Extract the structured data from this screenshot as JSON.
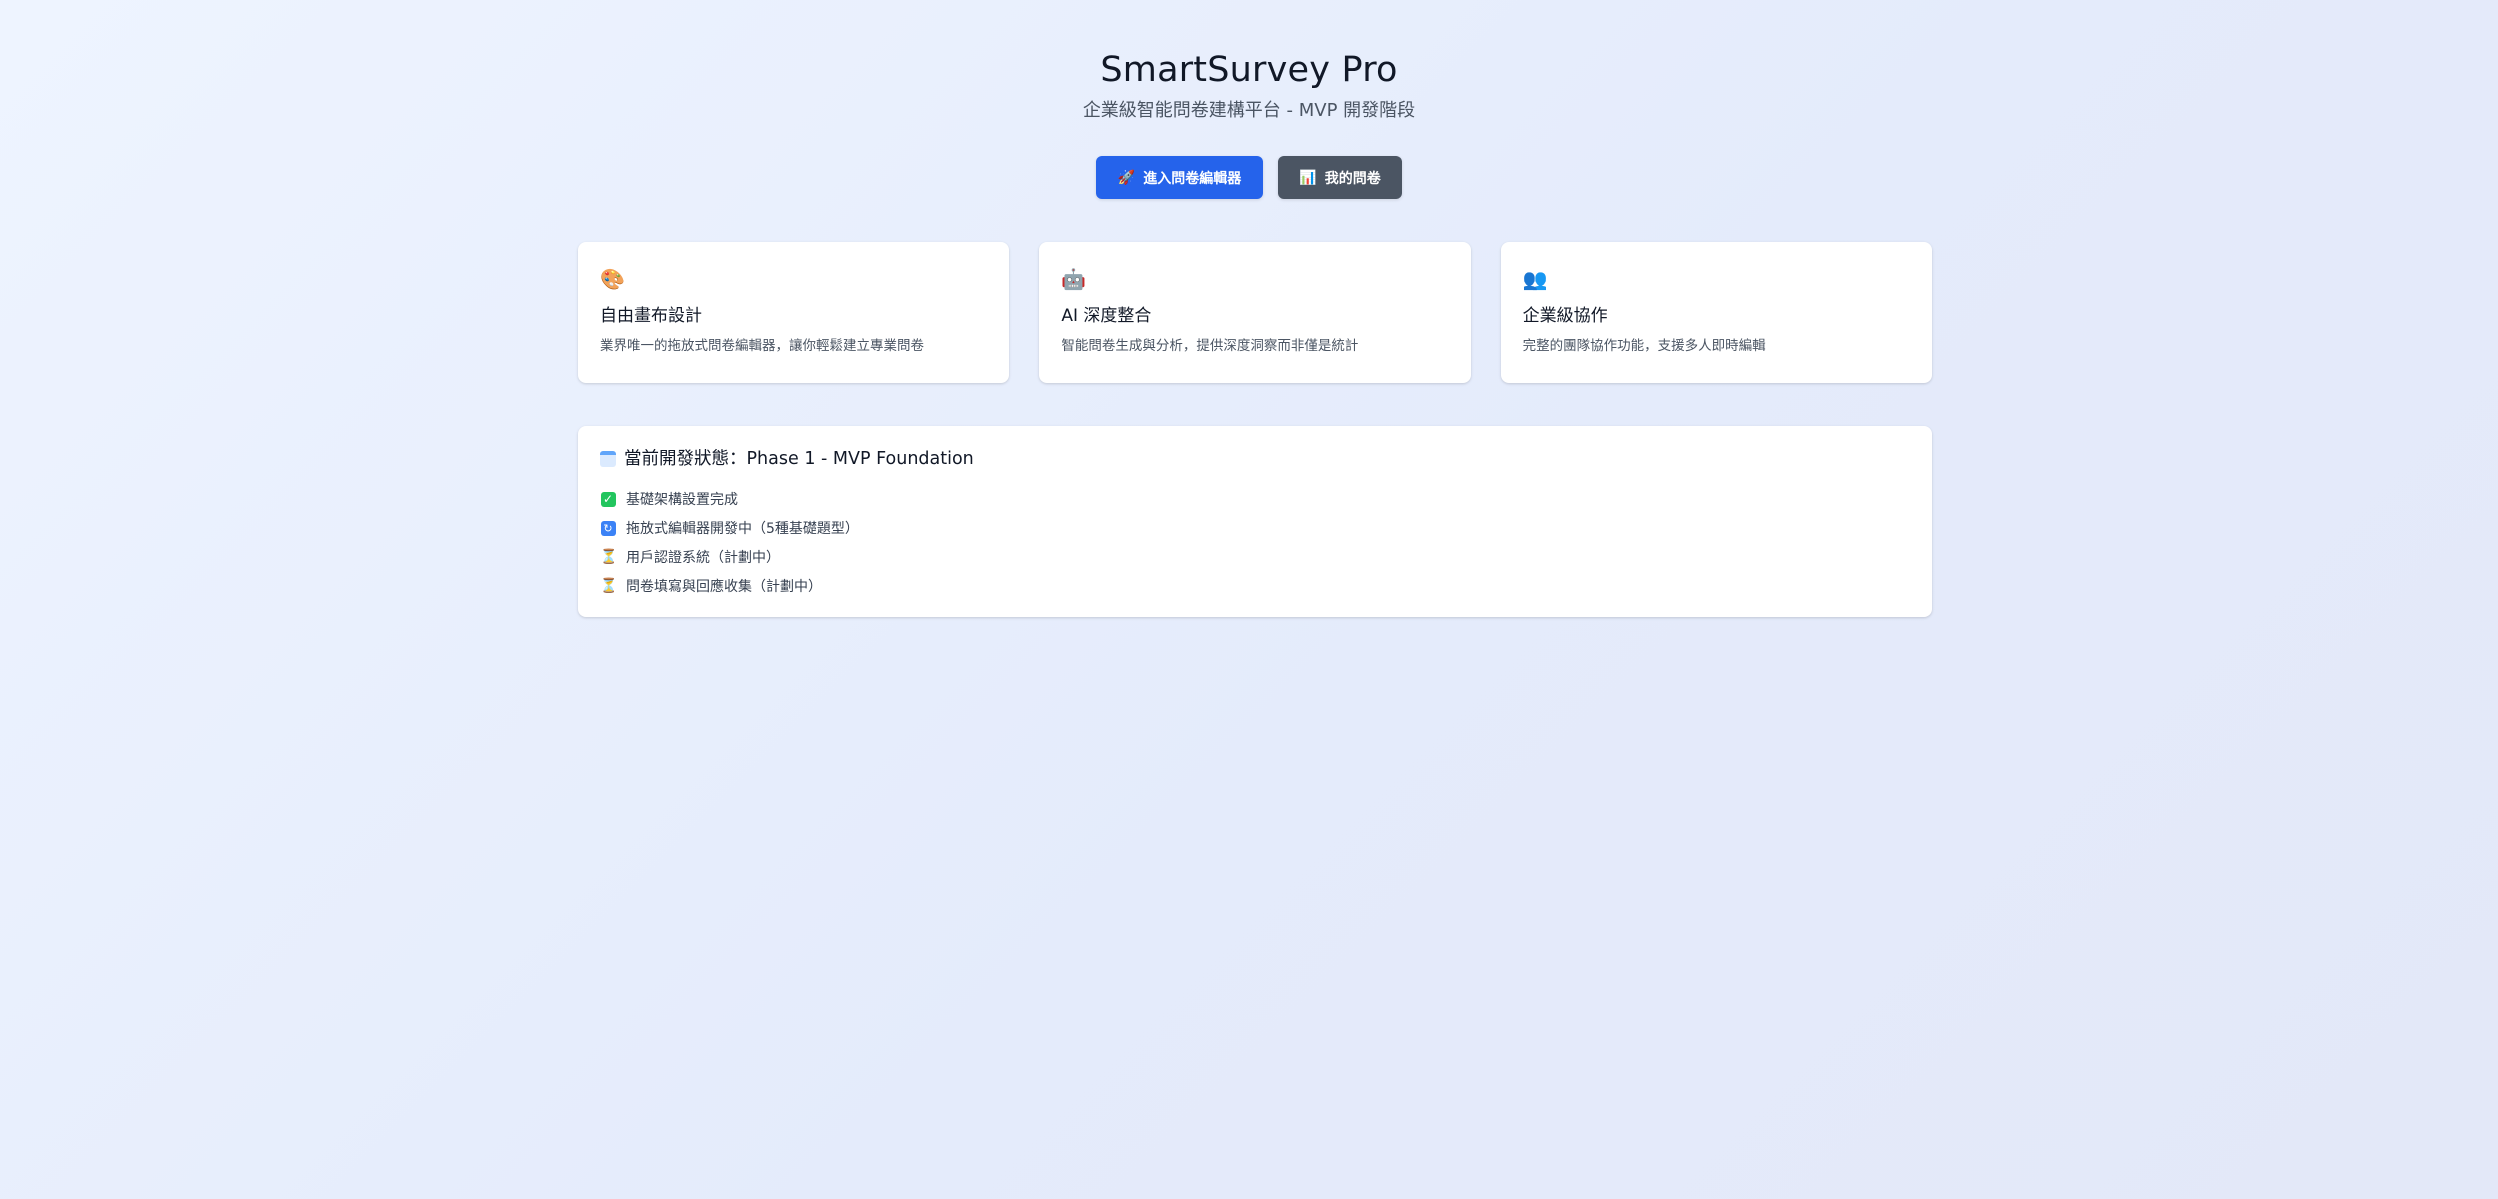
{
  "hero": {
    "title": "SmartSurvey Pro",
    "subtitle": "企業級智能問卷建構平台 - MVP 開發階段"
  },
  "actions": {
    "editor_icon": "🚀",
    "editor_label": "進入問卷編輯器",
    "my_surveys_icon": "📊",
    "my_surveys_label": "我的問卷"
  },
  "features": [
    {
      "icon": "🎨",
      "title": "自由畫布設計",
      "desc": "業界唯一的拖放式問卷編輯器，讓你輕鬆建立專業問卷"
    },
    {
      "icon": "🤖",
      "title": "AI 深度整合",
      "desc": "智能問卷生成與分析，提供深度洞察而非僅是統計"
    },
    {
      "icon": "👥",
      "title": "企業級協作",
      "desc": "完整的團隊協作功能，支援多人即時編輯"
    }
  ],
  "status": {
    "heading": "當前開發狀態：Phase 1 - MVP Foundation",
    "items": [
      {
        "icon": "check-icon",
        "label": "基礎架構設置完成"
      },
      {
        "icon": "refresh-icon",
        "label": "拖放式編輯器開發中（5種基礎題型）"
      },
      {
        "icon": "hourglass-icon",
        "label": "用戶認證系統（計劃中）"
      },
      {
        "icon": "hourglass-icon",
        "label": "問卷填寫與回應收集（計劃中）"
      }
    ]
  }
}
